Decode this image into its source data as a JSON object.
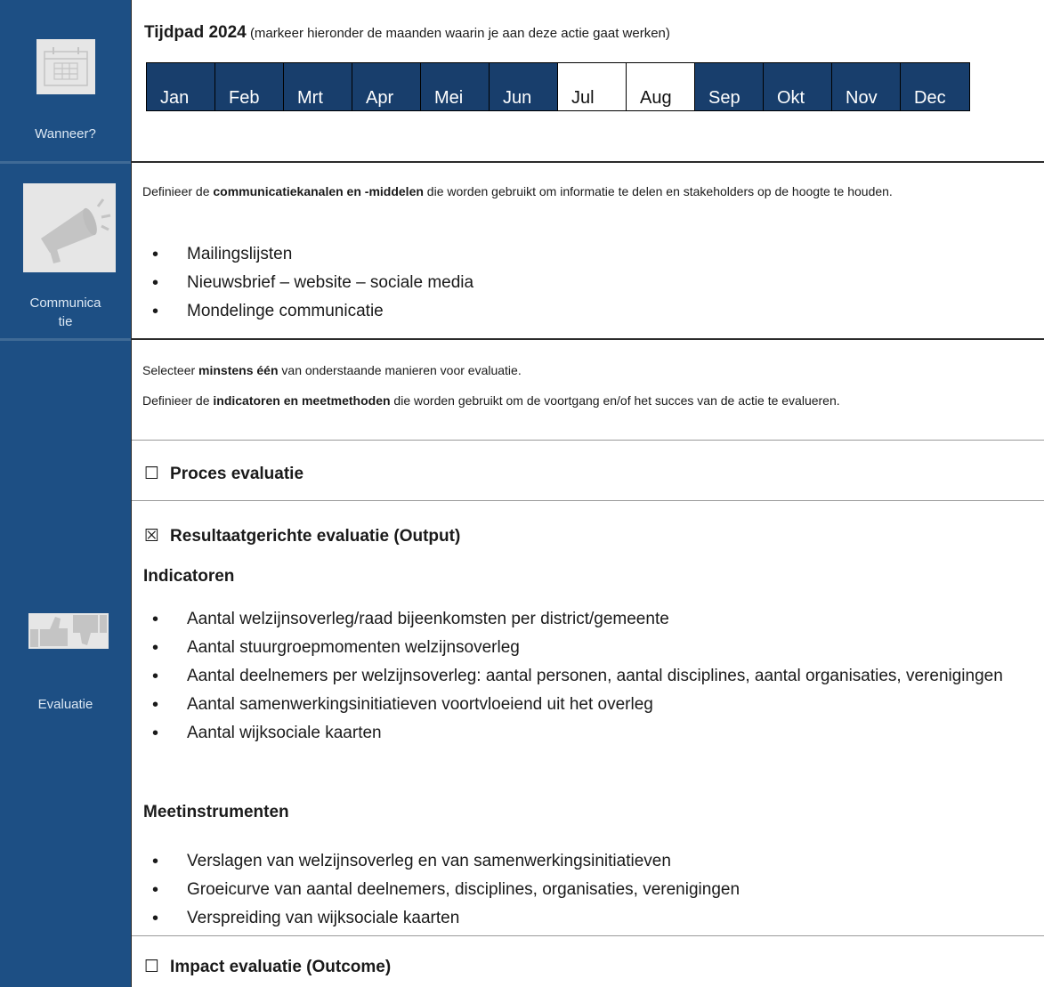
{
  "timeline": {
    "title": "Tijdpad 2024",
    "subtitle": "(markeer hieronder de maanden waarin je aan deze actie gaat werken)",
    "months": [
      {
        "label": "Jan",
        "selected": false
      },
      {
        "label": "Feb",
        "selected": false
      },
      {
        "label": "Mrt",
        "selected": false
      },
      {
        "label": "Apr",
        "selected": false
      },
      {
        "label": "Mei",
        "selected": false
      },
      {
        "label": "Jun",
        "selected": false
      },
      {
        "label": "Jul",
        "selected": true
      },
      {
        "label": "Aug",
        "selected": true
      },
      {
        "label": "Sep",
        "selected": false
      },
      {
        "label": "Okt",
        "selected": false
      },
      {
        "label": "Nov",
        "selected": false
      },
      {
        "label": "Dec",
        "selected": false
      }
    ]
  },
  "sections": {
    "wanneer": {
      "label": "Wanneer?",
      "icon": "calendar-icon"
    },
    "communicatie": {
      "label_line1": "Communica",
      "label_line2": "tie",
      "icon": "megaphone-icon"
    },
    "evaluatie": {
      "label": "Evaluatie",
      "icon": "thumbs-up-down-icon"
    }
  },
  "communicatie": {
    "intro_pre": "Definieer de ",
    "intro_bold": "communicatiekanalen en -middelen",
    "intro_post": " die worden gebruikt om informatie te delen en stakeholders op de hoogte te houden.",
    "items": [
      "Mailingslijsten",
      "Nieuwsbrief – website – sociale media",
      "Mondelinge communicatie"
    ]
  },
  "evaluatie": {
    "select_pre": "Selecteer ",
    "select_bold": "minstens één",
    "select_post": " van onderstaande manieren voor evaluatie.",
    "define_pre": "Definieer de ",
    "define_bold": "indicatoren en meetmethoden",
    "define_post": " die worden gebruikt om de voortgang en/of het succes van de actie te evalueren.",
    "proces": {
      "checkbox": "☐",
      "label": "Proces evaluatie",
      "checked": false
    },
    "output": {
      "checkbox": "☒",
      "label": "Resultaatgerichte evaluatie (Output)",
      "checked": true
    },
    "indicatoren_title": "Indicatoren",
    "indicatoren": [
      "Aantal welzijnsoverleg/raad bijeenkomsten per district/gemeente",
      "Aantal stuurgroepmomenten welzijnsoverleg",
      "Aantal deelnemers per welzijnsoverleg: aantal personen, aantal disciplines, aantal organisaties, verenigingen",
      "Aantal samenwerkingsinitiatieven voortvloeiend uit het overleg",
      "Aantal wijksociale kaarten"
    ],
    "meetinstrumenten_title": "Meetinstrumenten",
    "meetinstrumenten": [
      "Verslagen van welzijnsoverleg en van samenwerkingsinitiatieven",
      "Groeicurve van aantal deelnemers, disciplines, organisaties, verenigingen",
      "Verspreiding van wijksociale kaarten"
    ],
    "impact": {
      "checkbox": "☐",
      "label": "Impact evaluatie (Outcome)",
      "checked": false
    }
  },
  "colors": {
    "sidebar": "#1d4f84",
    "month_fill": "#183e6c",
    "month_selected": "#ffffff"
  }
}
